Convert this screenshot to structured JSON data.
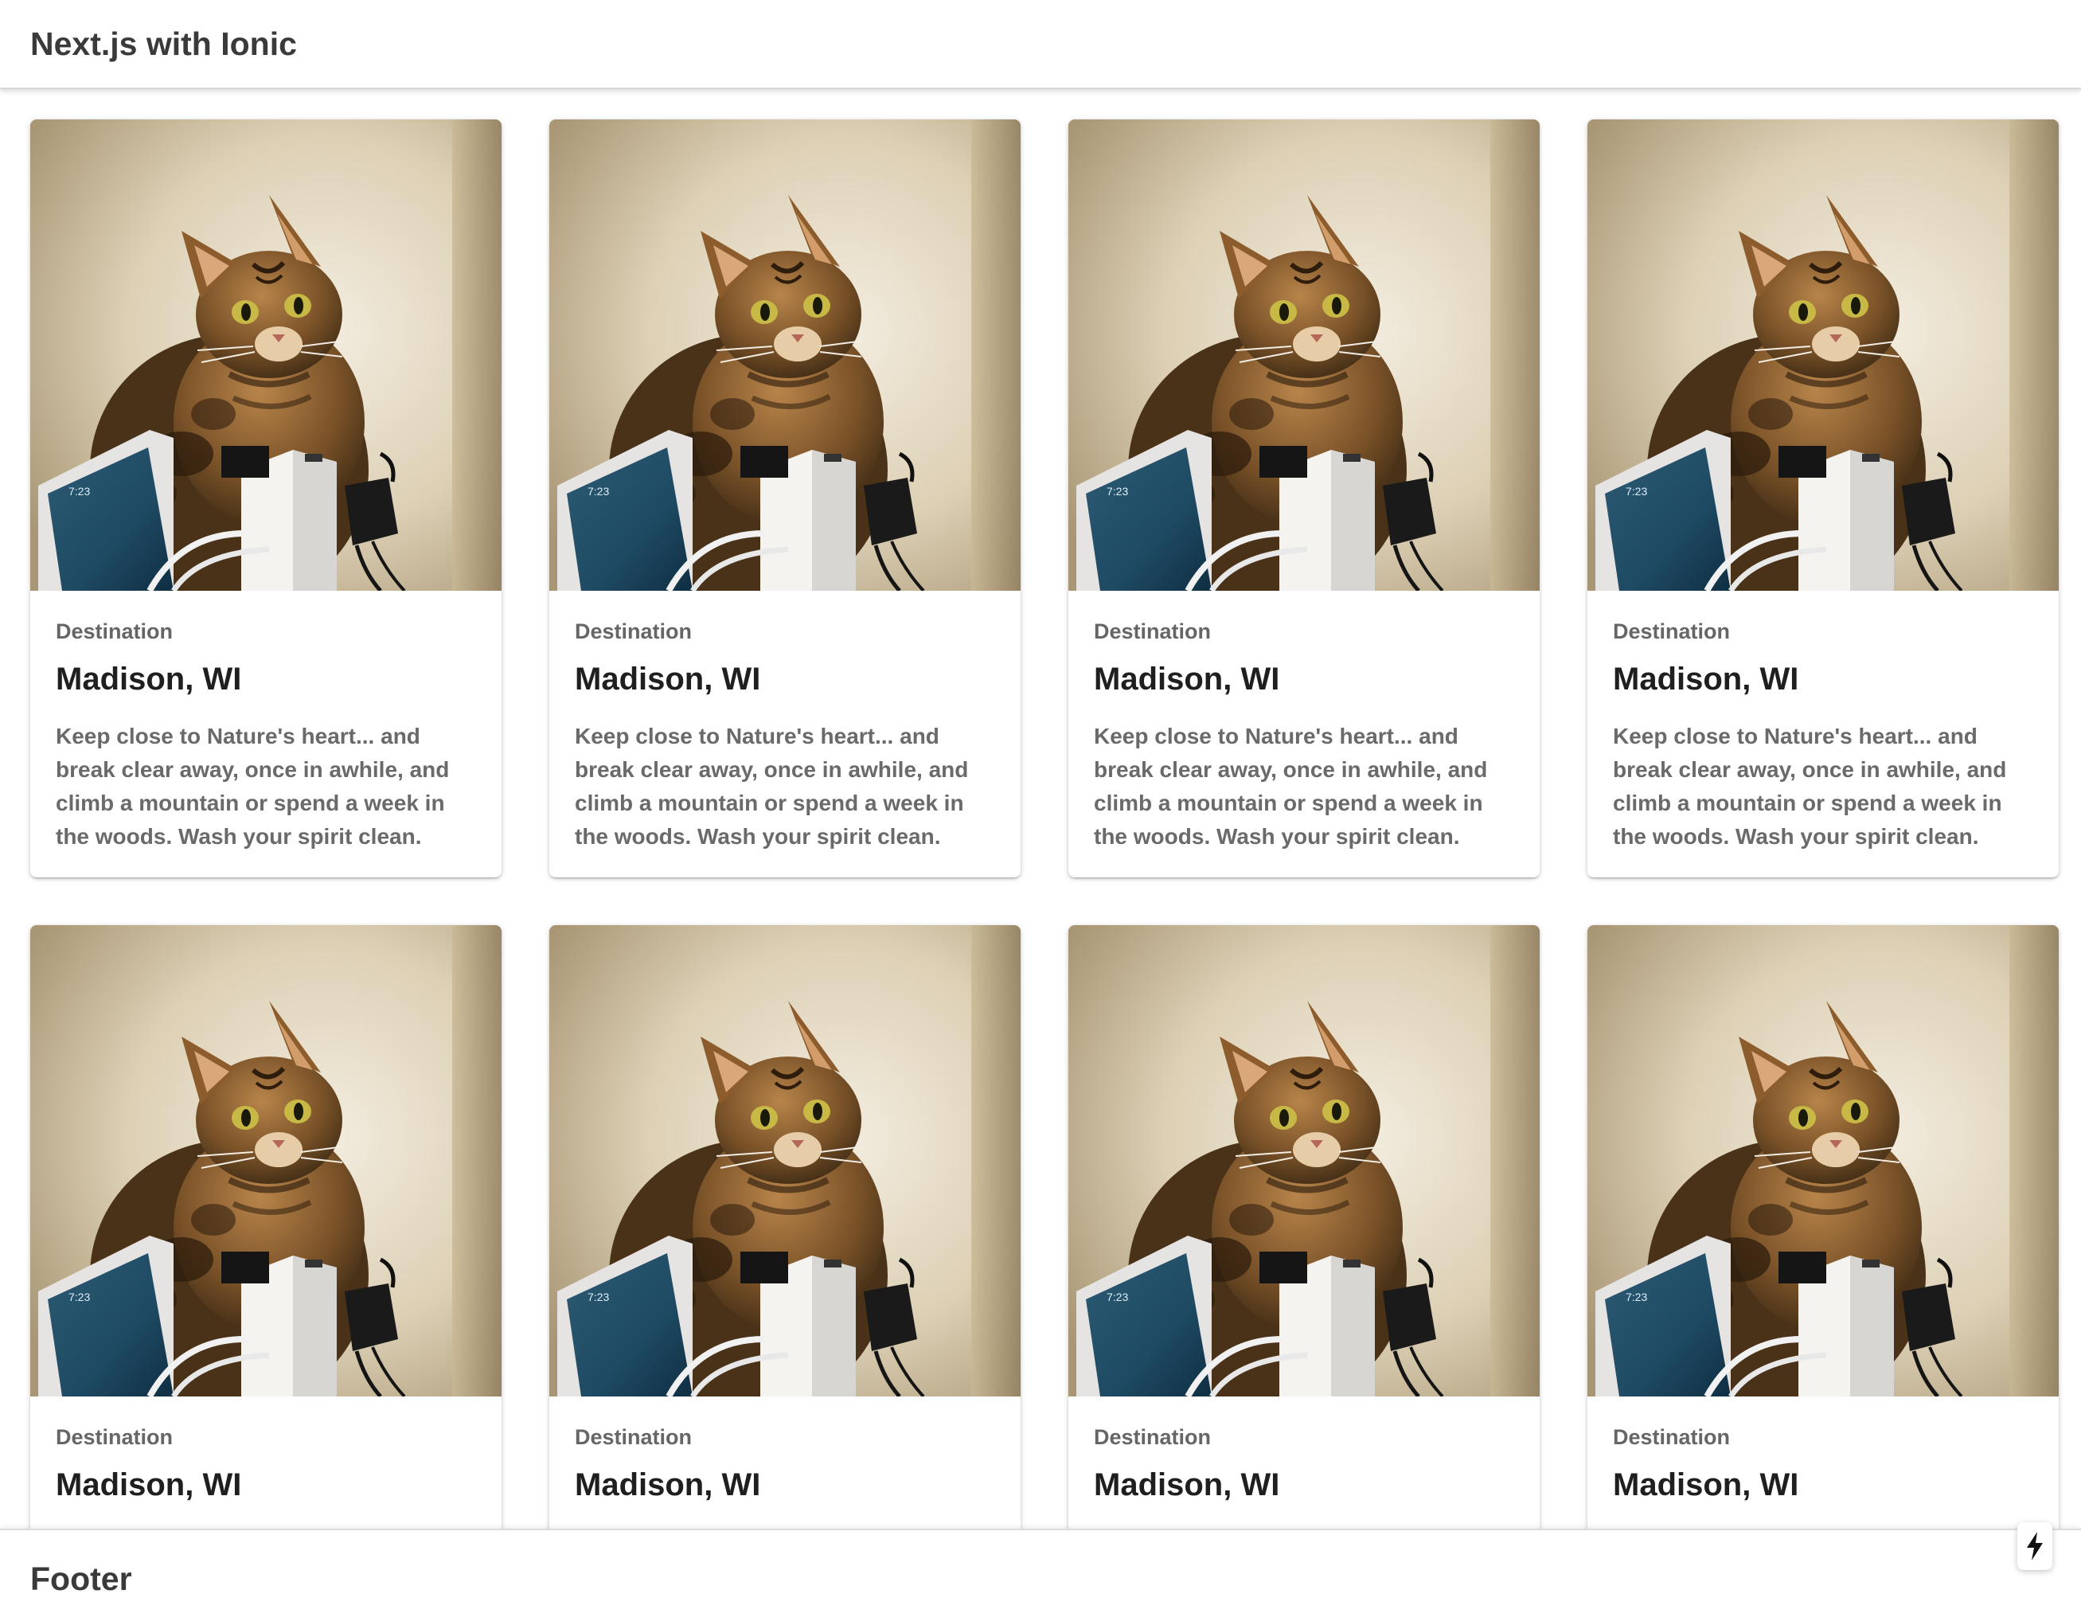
{
  "header": {
    "title": "Next.js with Ionic"
  },
  "cards": [
    {
      "subtitle": "Destination",
      "title": "Madison, WI",
      "text": "Keep close to Nature's heart... and break clear away, once in awhile, and climb a mountain or spend a week in the woods. Wash your spirit clean.",
      "image_icon": "cat-photo"
    },
    {
      "subtitle": "Destination",
      "title": "Madison, WI",
      "text": "Keep close to Nature's heart... and break clear away, once in awhile, and climb a mountain or spend a week in the woods. Wash your spirit clean.",
      "image_icon": "cat-photo"
    },
    {
      "subtitle": "Destination",
      "title": "Madison, WI",
      "text": "Keep close to Nature's heart... and break clear away, once in awhile, and climb a mountain or spend a week in the woods. Wash your spirit clean.",
      "image_icon": "cat-photo"
    },
    {
      "subtitle": "Destination",
      "title": "Madison, WI",
      "text": "Keep close to Nature's heart... and break clear away, once in awhile, and climb a mountain or spend a week in the woods. Wash your spirit clean.",
      "image_icon": "cat-photo"
    },
    {
      "subtitle": "Destination",
      "title": "Madison, WI",
      "text": "",
      "image_icon": "cat-photo"
    },
    {
      "subtitle": "Destination",
      "title": "Madison, WI",
      "text": "",
      "image_icon": "cat-photo"
    },
    {
      "subtitle": "Destination",
      "title": "Madison, WI",
      "text": "",
      "image_icon": "cat-photo"
    },
    {
      "subtitle": "Destination",
      "title": "Madison, WI",
      "text": "",
      "image_icon": "cat-photo"
    }
  ],
  "footer": {
    "title": "Footer"
  },
  "dev_indicator": {
    "icon": "lightning-bolt-icon"
  },
  "colors": {
    "header_text": "#3a3a3a",
    "card_subtitle": "#666666",
    "card_title": "#1f1f1f",
    "card_text": "#6a6a6a",
    "background": "#ffffff"
  }
}
